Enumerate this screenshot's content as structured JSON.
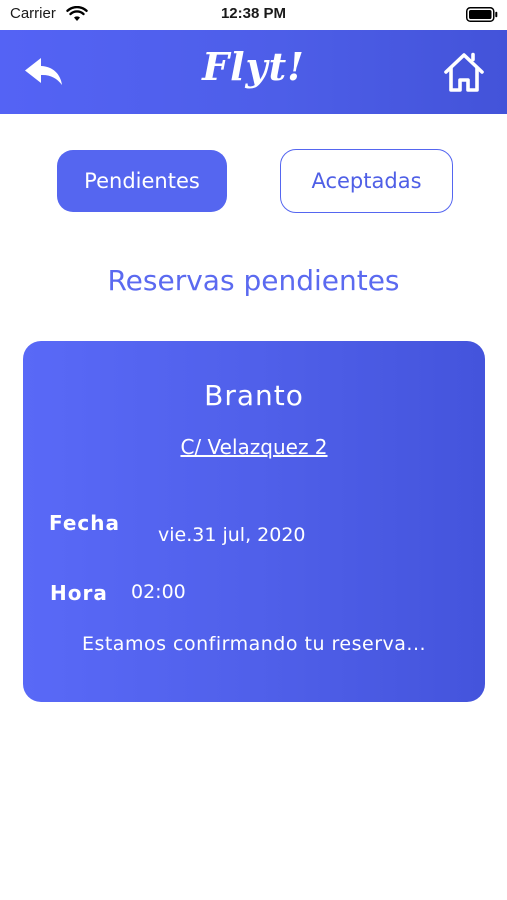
{
  "status_bar": {
    "carrier": "Carrier",
    "time": "12:38 PM"
  },
  "header": {
    "brand": "Flyt!"
  },
  "tabs": [
    {
      "label": "Pendientes",
      "active": true
    },
    {
      "label": "Aceptadas",
      "active": false
    }
  ],
  "section_title": "Reservas pendientes",
  "reservation": {
    "name": "Branto",
    "address": "C/ Velazquez 2",
    "date_label": "Fecha",
    "date_value": "vie.31 jul, 2020",
    "time_label": "Hora",
    "time_value": "02:00",
    "status_message": "Estamos confirmando tu reserva..."
  },
  "colors": {
    "accent": "#5566f0",
    "header_gradient_start": "#5463f5",
    "header_gradient_end": "#4353d9"
  },
  "icons": {
    "back": "undo-arrow-icon",
    "home": "home-icon",
    "wifi": "wifi-icon",
    "battery": "battery-icon"
  }
}
